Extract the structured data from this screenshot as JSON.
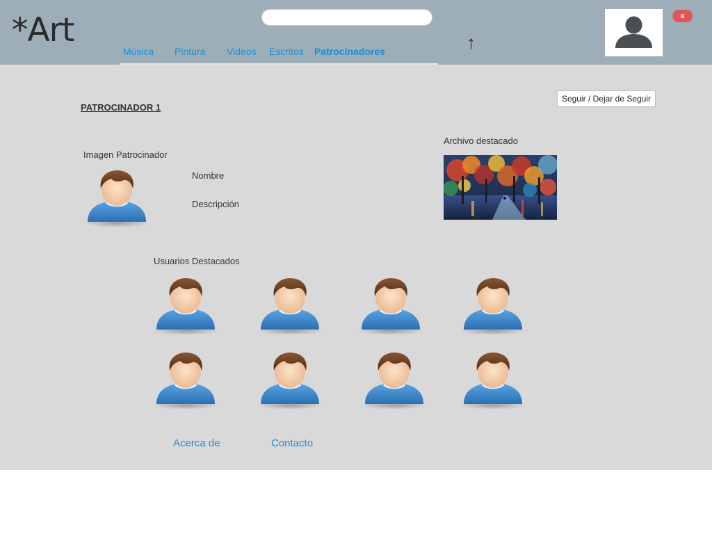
{
  "header": {
    "logo": "*Art",
    "search": {
      "value": "",
      "placeholder": ""
    },
    "nav": [
      {
        "label": "Música",
        "active": false
      },
      {
        "label": "Pintura",
        "active": false
      },
      {
        "label": "Videos",
        "active": false
      },
      {
        "label": "Escritos",
        "active": false
      },
      {
        "label": "Patrocinadores",
        "active": true
      }
    ],
    "up_arrow": "↑",
    "close_label": "x"
  },
  "sponsor": {
    "title": "PATROCINADOR 1",
    "follow_button": "Seguir / Dejar de Seguir",
    "image_label": "Imagen Patrocinador",
    "name_label": "Nombre",
    "description_label": "Descripción",
    "featured_label": "Archivo destacado",
    "featured_users_label": "Usuarios Destacados",
    "featured_users_count": 8
  },
  "footer": {
    "about": "Acerca de",
    "contact": "Contacto"
  },
  "colors": {
    "header_bg": "#9eaeb8",
    "main_bg": "#d9d9d9",
    "link": "#1f8ed6",
    "close_button": "#e05555",
    "user_shirt": "#3d87c9",
    "user_hair": "#6b3e22"
  },
  "icons": {
    "profile": "user-silhouette-icon",
    "user": "user-avatar-icon",
    "close": "close-icon",
    "up": "up-arrow-icon"
  }
}
